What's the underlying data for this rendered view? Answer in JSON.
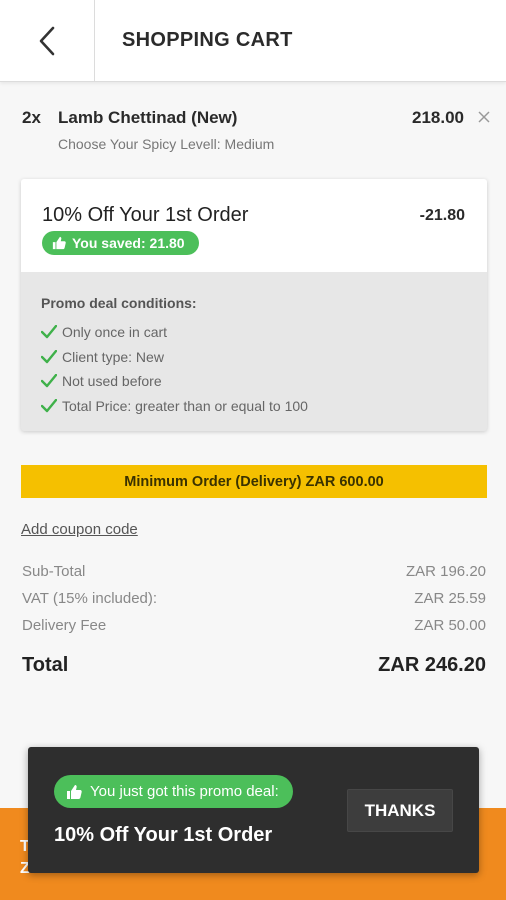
{
  "header": {
    "title": "SHOPPING CART",
    "back_icon": "chevron-left-icon"
  },
  "cart_item": {
    "quantity": "2x",
    "name": "Lamb Chettinad (New)",
    "price": "218.00",
    "option": "Choose Your Spicy Levell: Medium",
    "remove_icon": "close-icon"
  },
  "promo": {
    "name": "10% Off Your 1st Order",
    "discount": "-21.80",
    "saved_label": "You saved: 21.80",
    "conditions_title": "Promo deal conditions:",
    "conditions": [
      "Only once in cart",
      "Client type: New",
      "Not used before",
      "Total Price: greater than or equal to 100"
    ]
  },
  "min_order": "Minimum Order (Delivery) ZAR 600.00",
  "coupon_link": "Add coupon code",
  "totals": {
    "rows": [
      {
        "label": "Sub-Total",
        "value": "ZAR 196.20"
      },
      {
        "label": "VAT (15% included):",
        "value": "ZAR 25.59"
      },
      {
        "label": "Delivery Fee",
        "value": "ZAR 50.00"
      }
    ],
    "total_label": "Total",
    "total_value": "ZAR 246.20"
  },
  "checkout_bar": {
    "peek_line1": "T",
    "peek_line2": "Z"
  },
  "toast": {
    "pill_text": "You just got this promo deal:",
    "promo_name": "10% Off Your 1st Order",
    "button_label": "THANKS"
  },
  "colors": {
    "accent_orange": "#f08a1e",
    "promo_green": "#4cbf5a",
    "min_order_yellow": "#f5c000",
    "toast_bg": "#2e2e2e"
  }
}
